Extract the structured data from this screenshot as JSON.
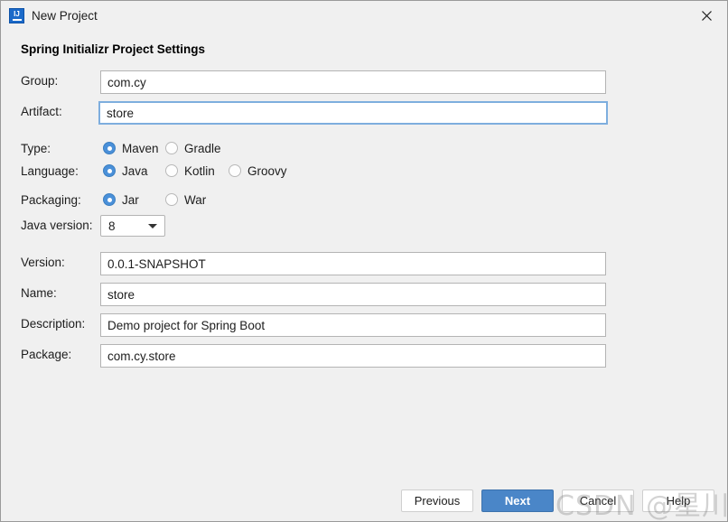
{
  "window": {
    "title": "New Project",
    "app_icon": "intellij-idea-icon",
    "icon_text": "IJ",
    "close_icon": "close-icon"
  },
  "section": {
    "header": "Spring Initializr Project Settings"
  },
  "form": {
    "group": {
      "label": "Group:",
      "value": "com.cy"
    },
    "artifact": {
      "label": "Artifact:",
      "value": "store",
      "focused": true
    },
    "type": {
      "label": "Type:",
      "options": [
        {
          "label": "Maven",
          "selected": true
        },
        {
          "label": "Gradle",
          "selected": false
        }
      ]
    },
    "language": {
      "label": "Language:",
      "options": [
        {
          "label": "Java",
          "selected": true
        },
        {
          "label": "Kotlin",
          "selected": false
        },
        {
          "label": "Groovy",
          "selected": false
        }
      ]
    },
    "packaging": {
      "label": "Packaging:",
      "options": [
        {
          "label": "Jar",
          "selected": true
        },
        {
          "label": "War",
          "selected": false
        }
      ]
    },
    "java_version": {
      "label": "Java version:",
      "value": "8"
    },
    "version": {
      "label": "Version:",
      "value": "0.0.1-SNAPSHOT"
    },
    "name": {
      "label": "Name:",
      "value": "store"
    },
    "description": {
      "label": "Description:",
      "value": "Demo project for Spring Boot"
    },
    "package": {
      "label": "Package:",
      "value": "com.cy.store"
    }
  },
  "buttons": {
    "previous": "Previous",
    "next": "Next",
    "cancel": "Cancel",
    "help": "Help"
  },
  "watermark": {
    "text": "CSDN @星川皆无恙"
  },
  "colors": {
    "accent": "#4a90d9",
    "primary_button": "#4a86c8",
    "dialog_background": "#f0f0f0",
    "field_border": "#b4b4b4",
    "focus_border": "#7eaede"
  }
}
